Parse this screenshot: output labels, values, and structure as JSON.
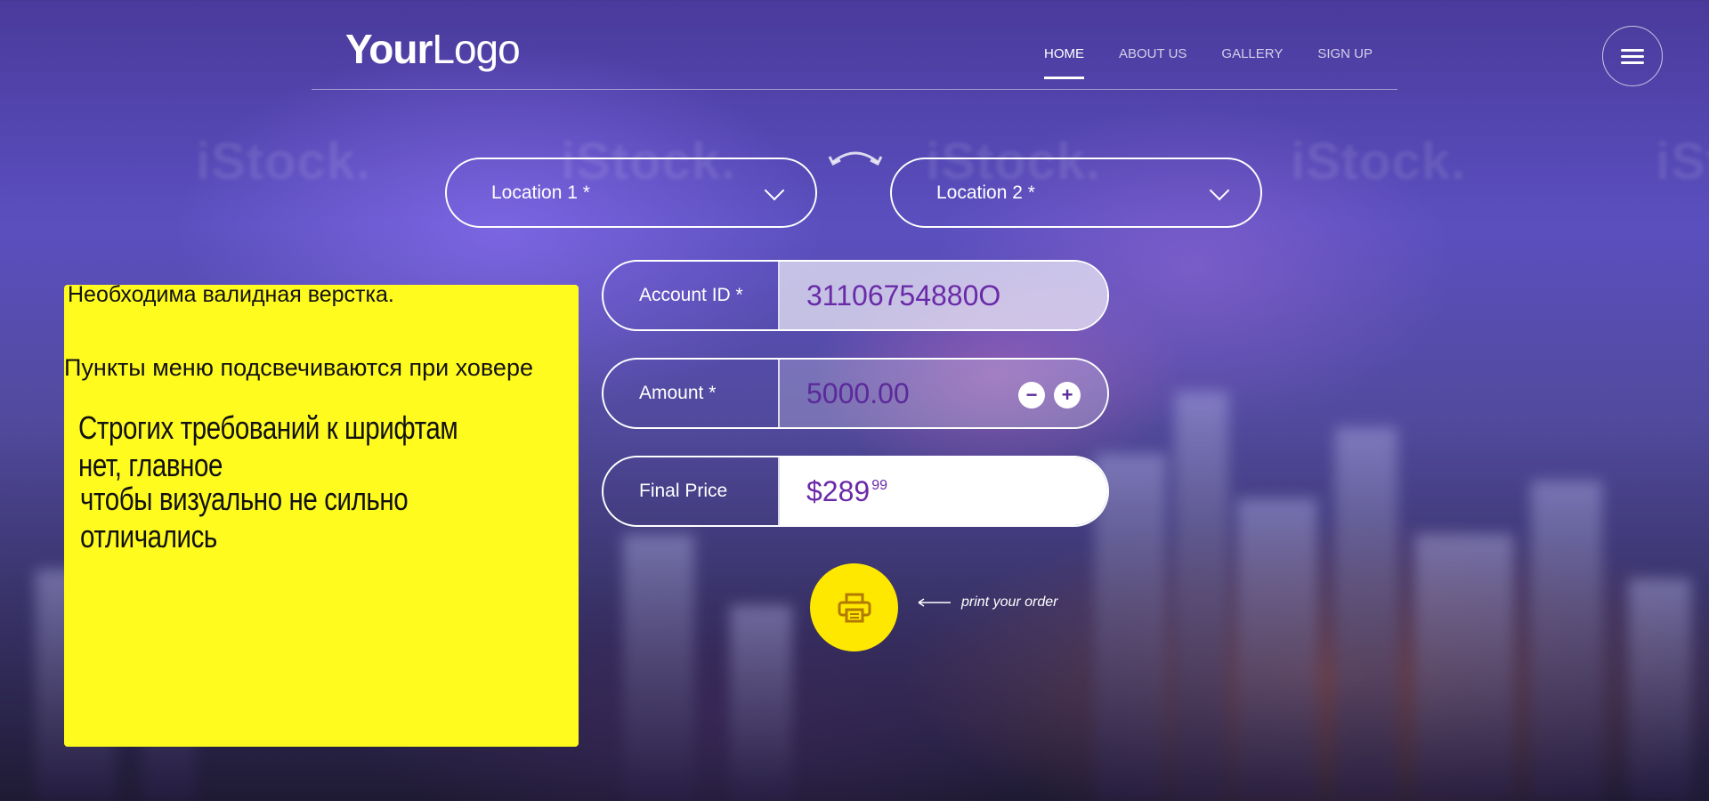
{
  "header": {
    "logo": {
      "bold": "Your",
      "light": "Logo"
    },
    "nav": [
      {
        "label": "HOME",
        "active": true
      },
      {
        "label": "ABOUT US"
      },
      {
        "label": "GALLERY"
      },
      {
        "label": "SIGN UP"
      }
    ],
    "menu_icon": "hamburger-icon"
  },
  "watermarks": [
    "iStock.",
    "iStock.",
    "iStock.",
    "iStock.",
    "iStock."
  ],
  "locations": {
    "from": {
      "placeholder": "Location 1 *"
    },
    "to": {
      "placeholder": "Location 2 *"
    },
    "swap_icon": "swap-arrows-icon"
  },
  "form": {
    "account": {
      "label": "Account ID *",
      "value": "31106754880O"
    },
    "amount": {
      "label": "Amount *",
      "value": "5000.00",
      "minus": "−",
      "plus": "+"
    },
    "final": {
      "label": "Final Price",
      "dollars": "$289",
      "cents": "99"
    }
  },
  "print": {
    "icon": "printer-icon",
    "hint": "print your order"
  },
  "note": {
    "line1": "Необходима валидная верстка.",
    "line2": "Пункты меню подсвечиваются при ховере",
    "line3": "Строгих требований к шрифтам нет, главное",
    "line4": "чтобы визуально не сильно отличались"
  },
  "colors": {
    "accent": "#ffe800",
    "value_text": "#6a2aa8",
    "note_bg": "#fffb1f"
  }
}
